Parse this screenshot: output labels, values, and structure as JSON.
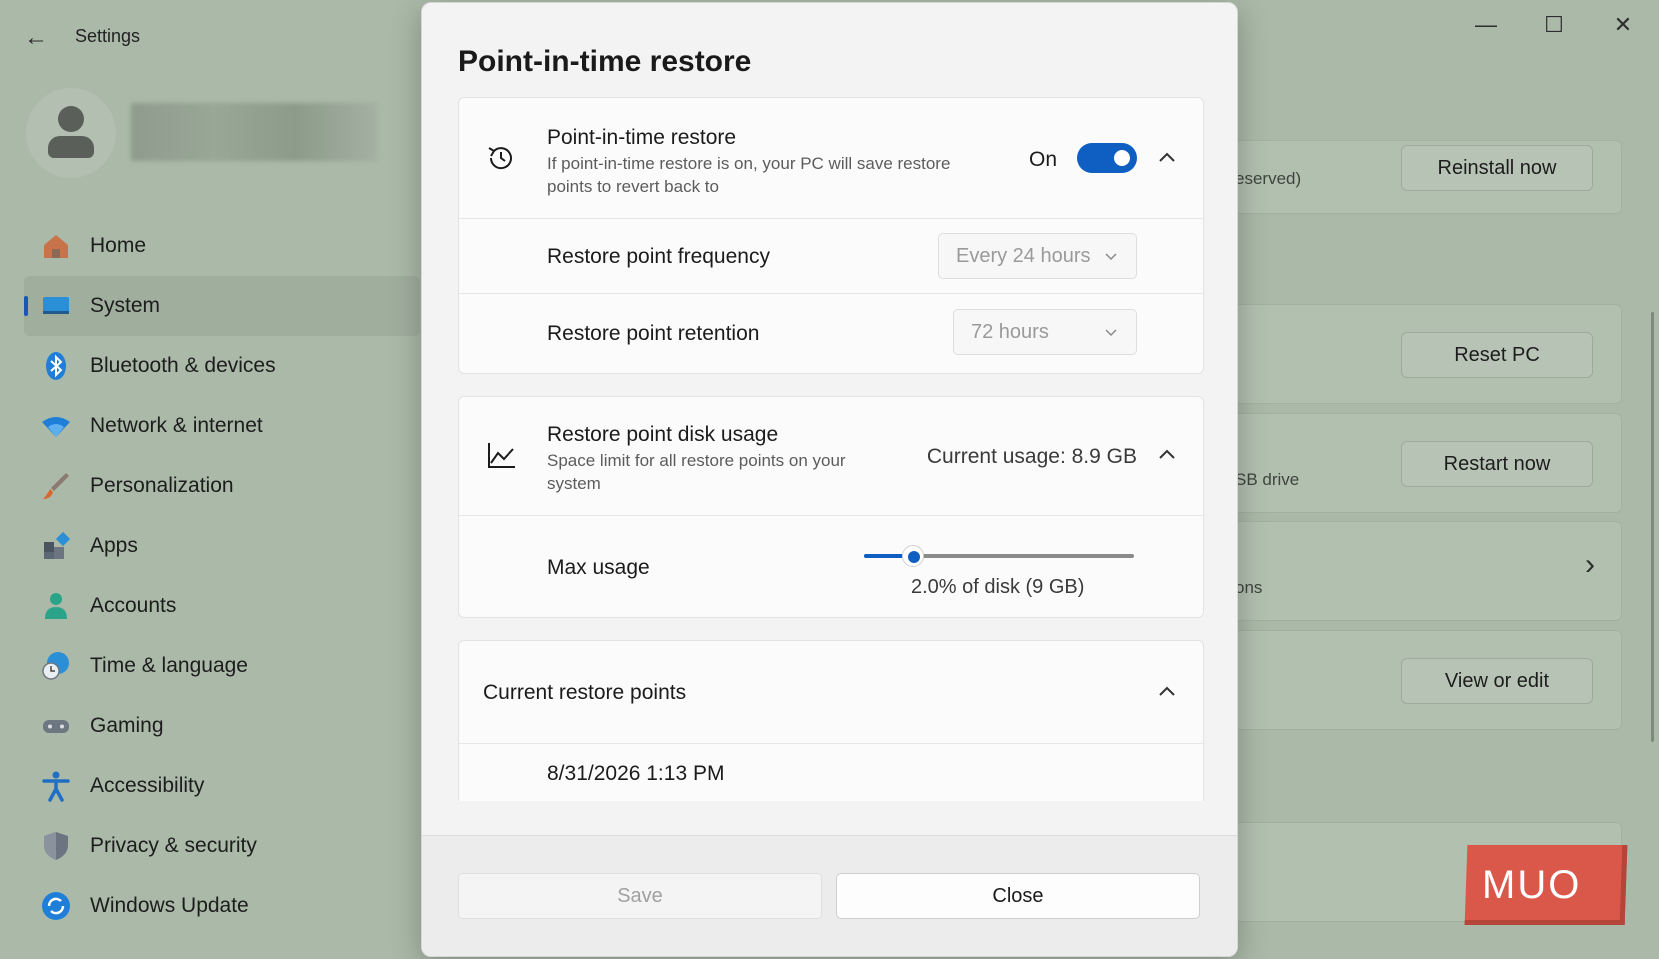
{
  "window": {
    "app_title": "Settings",
    "minimize_glyph": "—",
    "maximize_glyph": "☐",
    "close_glyph": "✕",
    "back_glyph": "←"
  },
  "sidebar": {
    "items": [
      {
        "label": "Home",
        "icon": "home-icon",
        "active": false
      },
      {
        "label": "System",
        "icon": "monitor-icon",
        "active": true
      },
      {
        "label": "Bluetooth & devices",
        "icon": "bluetooth-icon",
        "active": false
      },
      {
        "label": "Network & internet",
        "icon": "wifi-icon",
        "active": false
      },
      {
        "label": "Personalization",
        "icon": "brush-icon",
        "active": false
      },
      {
        "label": "Apps",
        "icon": "apps-icon",
        "active": false
      },
      {
        "label": "Accounts",
        "icon": "person-icon",
        "active": false
      },
      {
        "label": "Time & language",
        "icon": "globe-clock-icon",
        "active": false
      },
      {
        "label": "Gaming",
        "icon": "gamepad-icon",
        "active": false
      },
      {
        "label": "Accessibility",
        "icon": "accessibility-icon",
        "active": false
      },
      {
        "label": "Privacy & security",
        "icon": "shield-icon",
        "active": false
      },
      {
        "label": "Windows Update",
        "icon": "update-icon",
        "active": false
      }
    ]
  },
  "background": {
    "reinstall_button": "Reinstall now",
    "reserved_text": "eserved)",
    "reset_button": "Reset PC",
    "restart_button": "Restart now",
    "usb_text": "SB drive",
    "options_text": "ons",
    "chevron_glyph": "›",
    "view_edit_button": "View or edit"
  },
  "watermark": {
    "text": "MUO"
  },
  "dialog": {
    "title": "Point-in-time restore",
    "restore_section": {
      "title": "Point-in-time restore",
      "description": "If point-in-time restore is on, your PC will save restore points to revert back to",
      "toggle_label": "On",
      "toggle_on": true,
      "frequency_label": "Restore point frequency",
      "frequency_value": "Every 24 hours",
      "retention_label": "Restore point retention",
      "retention_value": "72 hours"
    },
    "disk_section": {
      "title": "Restore point disk usage",
      "description": "Space limit for all restore points on your system",
      "current_usage": "Current usage: 8.9 GB",
      "max_usage_label": "Max usage",
      "slider_fraction": 0.18,
      "slider_caption": "2.0% of disk (9 GB)"
    },
    "points_section": {
      "title": "Current restore points",
      "points": [
        "8/31/2026 1:13 PM"
      ]
    },
    "save_button": "Save",
    "close_button": "Close"
  }
}
